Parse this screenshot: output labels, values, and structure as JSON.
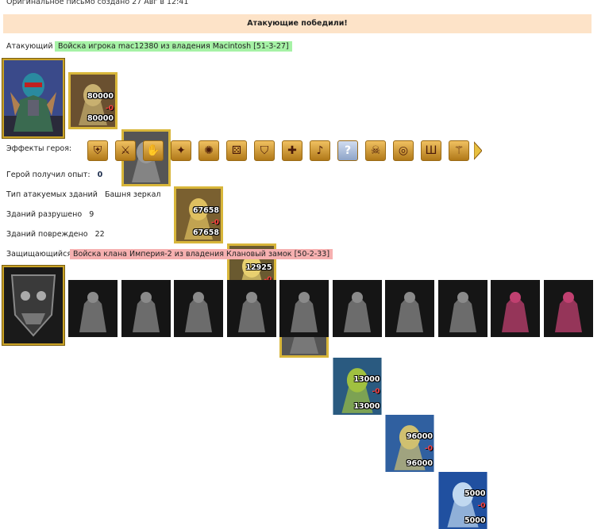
{
  "header": {
    "created": "Оригинальное письмо создано 27 Авг в 12:41",
    "banner": "Атакующие победили!"
  },
  "attacker": {
    "label": "Атакующий",
    "name": "Войска игрока mac12380 из владения Macintosh [51-3-27]",
    "units": [
      {
        "name": "unit-unicorn",
        "top": "80000",
        "loss": "-0",
        "bottom": "80000",
        "frame": "gold"
      },
      {
        "name": "unit-ghost-knight",
        "top": "",
        "loss": "",
        "bottom": "",
        "frame": "gold"
      },
      {
        "name": "unit-cavalier",
        "top": "67658",
        "loss": "-0",
        "bottom": "67658",
        "frame": "gold"
      },
      {
        "name": "unit-champion",
        "top": "12925",
        "loss": "-0",
        "bottom": "12925",
        "frame": "gold"
      },
      {
        "name": "unit-ghost-knight-2",
        "top": "",
        "loss": "",
        "bottom": "",
        "frame": "gold"
      },
      {
        "name": "unit-ogre",
        "top": "13000",
        "loss": "-0",
        "bottom": "13000",
        "frame": "plain"
      },
      {
        "name": "unit-swordsman",
        "top": "96000",
        "loss": "-0",
        "bottom": "96000",
        "frame": "plain"
      },
      {
        "name": "unit-mage",
        "top": "5000",
        "loss": "-0",
        "bottom": "5000",
        "frame": "plain"
      }
    ],
    "effects_label": "Эффекты героя:",
    "effects": [
      {
        "name": "shield-icon",
        "glyph": "⛨"
      },
      {
        "name": "sword-icon",
        "glyph": "⚔"
      },
      {
        "name": "handshake-icon",
        "glyph": "✋"
      },
      {
        "name": "rune-icon",
        "glyph": "✦"
      },
      {
        "name": "crab-icon",
        "glyph": "✺"
      },
      {
        "name": "dice-icon",
        "glyph": "⚄"
      },
      {
        "name": "green-shield-icon",
        "glyph": "⛉"
      },
      {
        "name": "cross-shield-icon",
        "glyph": "✚"
      },
      {
        "name": "horn-icon",
        "glyph": "♪"
      },
      {
        "name": "question-icon",
        "glyph": "?"
      },
      {
        "name": "skull-icon",
        "glyph": "☠"
      },
      {
        "name": "scroll-icon",
        "glyph": "◎"
      },
      {
        "name": "pillars-icon",
        "glyph": "Ш"
      },
      {
        "name": "staff-icon",
        "glyph": "⚚"
      }
    ],
    "exp_label": "Герой получил опыт:",
    "exp_value": "0"
  },
  "stats": {
    "building_type_label": "Тип атакуемых зданий",
    "building_type_value": "Башня зеркал",
    "destroyed_label": "Зданий разрушено",
    "destroyed_value": "9",
    "damaged_label": "Зданий повреждено",
    "damaged_value": "22"
  },
  "defender": {
    "label": "Защищающийся",
    "name": "Войска клана Империя-2 из владения Клановый замок [50-2-33]",
    "units": [
      "unit-dragon-dead",
      "unit-ogre-dead",
      "unit-demon-dead",
      "unit-gargoyle-dead",
      "unit-spider-dead",
      "unit-wraith-dead",
      "unit-harpy-dead",
      "unit-bone-dragon-dead",
      "unit-crystal-creature",
      "unit-jellyfish-creature"
    ]
  },
  "colors": {
    "banner_bg": "#fde3c8",
    "attacker_highlight": "#a6f2a6",
    "defender_highlight": "#f6b0b0",
    "gold_frame": "#d8b63a"
  }
}
